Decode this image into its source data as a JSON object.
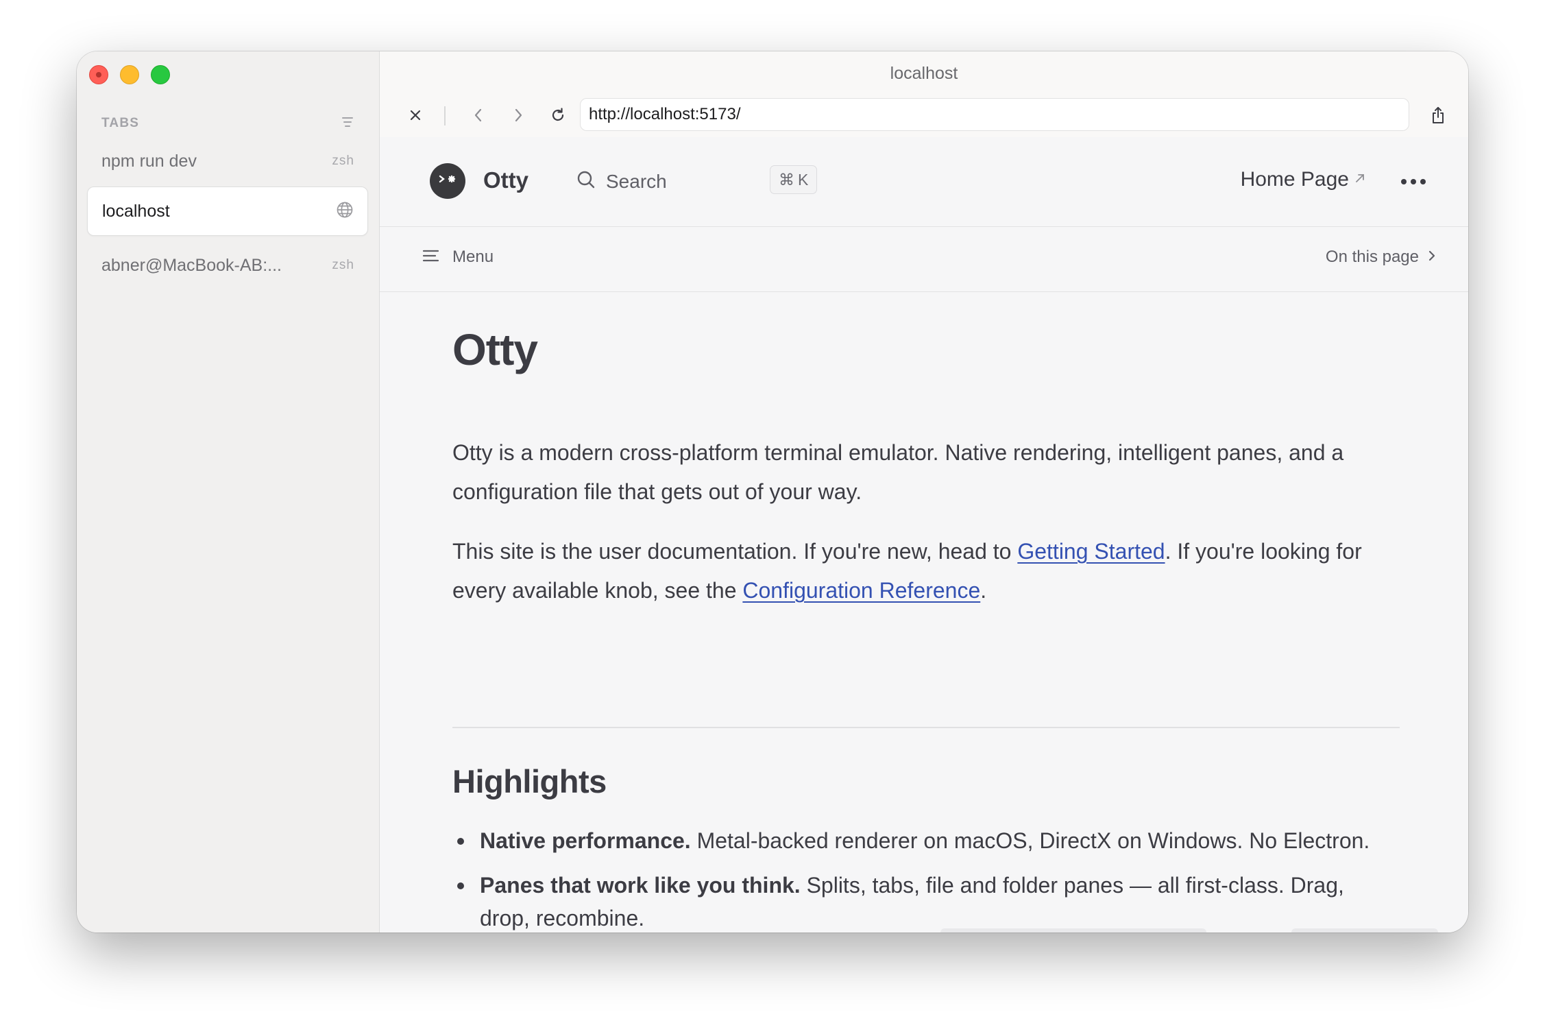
{
  "window": {
    "title": "localhost"
  },
  "sidebar": {
    "tabs_label": "TABS",
    "items": [
      {
        "title": "npm run dev",
        "subtitle": "zsh",
        "active": false
      },
      {
        "title": "localhost",
        "icon": "globe-icon",
        "active": true
      },
      {
        "title": "abner@MacBook-AB:...",
        "subtitle": "zsh",
        "active": false
      }
    ]
  },
  "browser": {
    "url": "http://localhost:5173/"
  },
  "site": {
    "brand": "Otty",
    "search_label": "Search",
    "shortcut_symbol": "⌘",
    "shortcut_key": "K",
    "home_link": "Home Page",
    "menu_label": "Menu",
    "on_this_page": "On this page"
  },
  "doc": {
    "title": "Otty",
    "intro": "Otty is a modern cross-platform terminal emulator. Native rendering, intelligent panes, and a configuration file that gets out of your way.",
    "p2_before": "This site is the user documentation. If you're new, head to ",
    "p2_link1": "Getting Started",
    "p2_middle": ". If you're looking for every available knob, see the ",
    "p2_link2": "Configuration Reference",
    "p2_after": ".",
    "highlights_title": "Highlights",
    "highlights": [
      {
        "bold": "Native performance.",
        "text": " Metal-backed renderer on macOS, DirectX on Windows. No Electron."
      },
      {
        "bold": "Panes that work like you think.",
        "text": " Splits, tabs, file and folder panes — all first-class. Drag, drop, recombine."
      }
    ]
  },
  "colors": {
    "accent_link": "#3451b2",
    "text": "#3c3c43",
    "close": "#ff5f57",
    "minimize": "#febc2e",
    "zoom": "#28c840"
  }
}
